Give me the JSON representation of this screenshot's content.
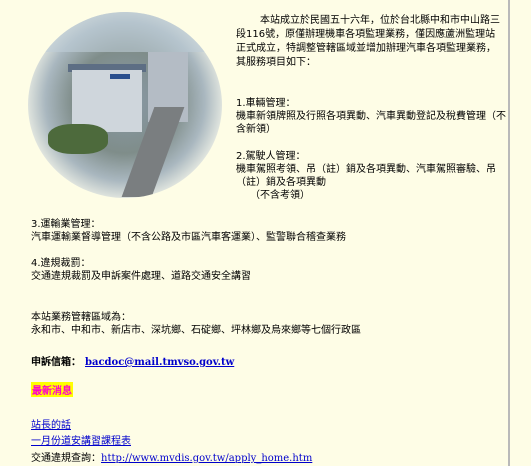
{
  "intro": "本站成立於民國五十六年，位於台北縣中和市中山路三段116號，原僅辦理機車各項監理業務，僅因應蘆洲監理站正式成立，特調整管轄區域並增加辦理汽車各項監理業務，其服務項目如下：",
  "services": [
    {
      "title": "1.車輛管理：",
      "lines": [
        "機車新領牌照及行照各項異動、汽車異動登記及稅費管理（不含新領）"
      ]
    },
    {
      "title": "2.駕駛人管理：",
      "lines": [
        "機車駕照考領、吊（註）銷及各項異動、汽車駕照審驗、吊（註）銷及各項異動",
        "（不含考領）"
      ]
    },
    {
      "title": "3.運輸業管理：",
      "lines": [
        "汽車運輸業督導管理（不含公路及市區汽車客運業）、監警聯合稽查業務"
      ]
    },
    {
      "title": "4.違規裁罰：",
      "lines": [
        "交通違規裁罰及申訴案件處理、道路交通安全講習"
      ]
    }
  ],
  "jurisdiction": {
    "title": "本站業務管轄區域為：",
    "text": "永和市、中和市、新店市、深坑鄉、石碇鄉、坪林鄉及烏來鄉等七個行政區"
  },
  "complaint": {
    "label": "申訴信箱：",
    "email": "bacdoc@mail.tmvso.gov.tw"
  },
  "news_label": "最新消息",
  "links": {
    "chief_words": "站長的話",
    "january_course": "一月份道安講習課程表",
    "query_label": "交通違規查詢：",
    "query_url": "http://www.mvdis.gov.tw/apply_home.htm"
  }
}
